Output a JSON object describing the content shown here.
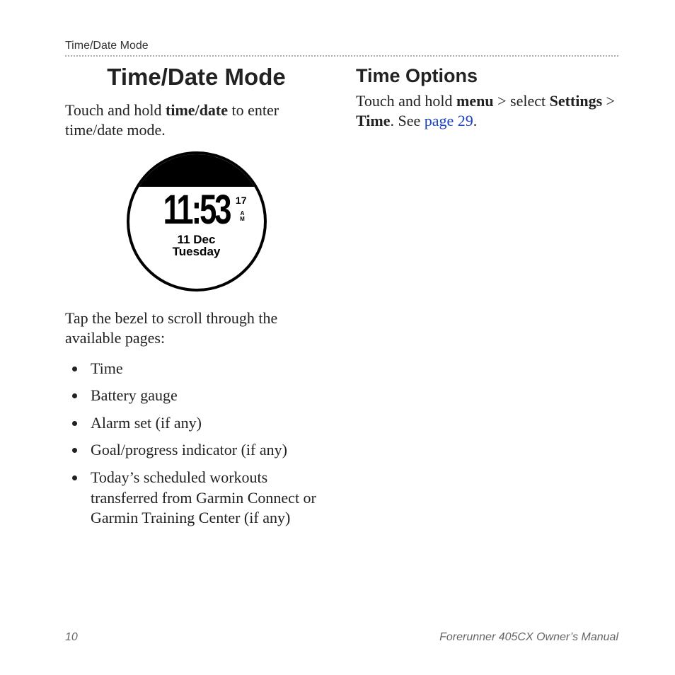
{
  "running_head": "Time/Date Mode",
  "left": {
    "title": "Time/Date Mode",
    "intro_pre": "Touch and hold ",
    "intro_bold": "time/date",
    "intro_post": " to enter time/date mode.",
    "watch": {
      "time": "11:53",
      "seconds": "17",
      "ampm_top": "A",
      "ampm_bottom": "M",
      "date": "11 Dec",
      "weekday": "Tuesday"
    },
    "scroll_intro": "Tap the bezel to scroll through the available pages:",
    "pages": [
      "Time",
      "Battery gauge",
      "Alarm set (if any)",
      "Goal/progress indicator (if any)",
      "Today’s scheduled workouts transferred from Garmin Connect or Garmin Training Center (if any)"
    ]
  },
  "right": {
    "title": "Time Options",
    "line_pre": "Touch and hold ",
    "menu": "menu",
    "sep1": " > select ",
    "settings": "Settings",
    "sep2": " > ",
    "time": "Time",
    "post": ". See ",
    "link": "page 29",
    "period": "."
  },
  "footer": {
    "page_num": "10",
    "manual": "Forerunner 405CX Owner’s Manual"
  }
}
